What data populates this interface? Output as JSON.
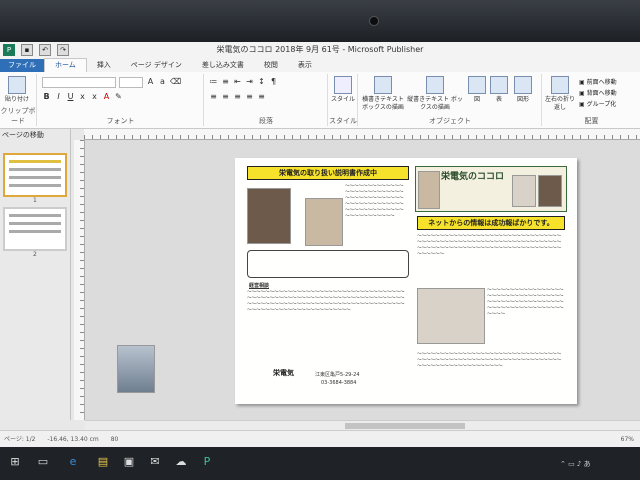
{
  "window": {
    "title": "栄電気のココロ 2018年 9月 61号 - Microsoft Publisher"
  },
  "ribbon": {
    "tabs": [
      "ファイル",
      "ホーム",
      "挿入",
      "ページ デザイン",
      "差し込み文書",
      "校閲",
      "表示"
    ],
    "groups": {
      "clipboard": "クリップボード",
      "font": "フォント",
      "paragraph": "段落",
      "styles": "スタイル",
      "objects": "オブジェクト",
      "arrange": "配置"
    },
    "buttons": {
      "paste": "貼り付け",
      "style": "スタイル",
      "draw_text_box": "横書きテキスト ボックスの描画",
      "draw_vertical_text_box": "縦書きテキスト ボックスの描画",
      "picture": "図",
      "table": "表",
      "shapes": "図形",
      "wrap_text": "左右の折り返し",
      "bring_forward": "前面へ移動",
      "send_backward": "背面へ移動",
      "group": "グループ化"
    }
  },
  "nav": {
    "header": "ページの移動",
    "pages": [
      "1",
      "2"
    ]
  },
  "document": {
    "left_banner": "栄電気の取り扱い説明書作成中",
    "right_banner": "ネットからの情報は成功報ばかりです。",
    "masthead": "栄電気のココロ",
    "section_label": "経営相談",
    "footer_company": "栄電気",
    "footer_address": "江東区亀戸5-29-24",
    "footer_phone": "03-3684-3884"
  },
  "status": {
    "page": "ページ: 1/2",
    "position": "-16.46, 13.40 cm",
    "size": "80",
    "zoom": "67%"
  }
}
